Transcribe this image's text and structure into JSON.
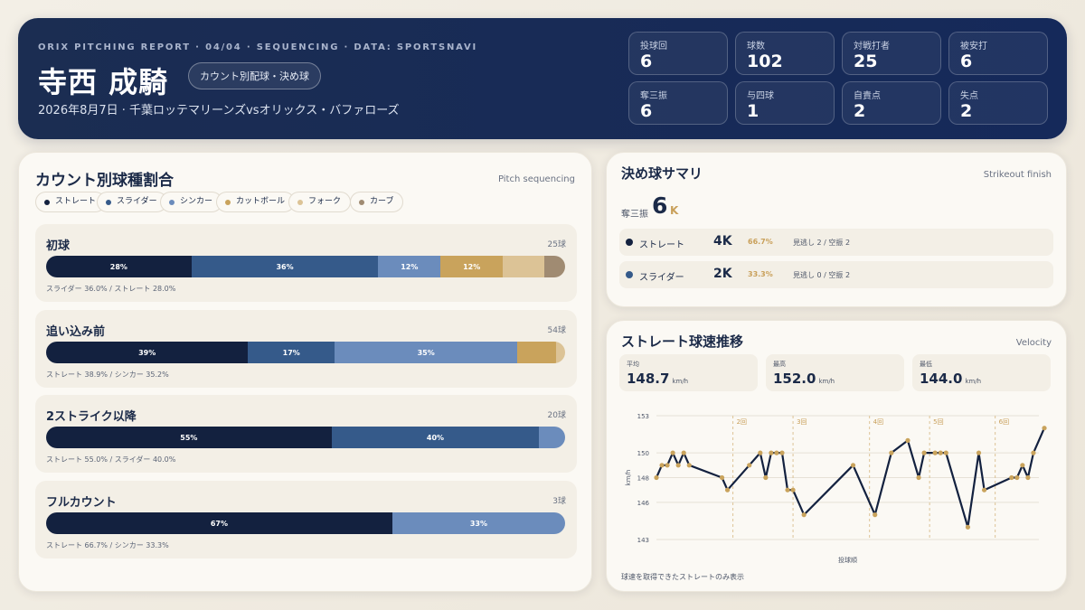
{
  "header": {
    "subtitle": "ORIX PITCHING REPORT · 04/04 · SEQUENCING · DATA: SPORTSNAVI",
    "pitcher_name": "寺西 成騎",
    "badge": "カウント別配球・決め球",
    "game": "2026年8月7日 · 千葉ロッテマリーンズvsオリックス・バファローズ",
    "stats": [
      {
        "label": "投球回",
        "value": "6"
      },
      {
        "label": "球数",
        "value": "102"
      },
      {
        "label": "対戦打者",
        "value": "25"
      },
      {
        "label": "被安打",
        "value": "6"
      },
      {
        "label": "奪三振",
        "value": "6"
      },
      {
        "label": "与四球",
        "value": "1"
      },
      {
        "label": "自責点",
        "value": "2"
      },
      {
        "label": "失点",
        "value": "2"
      }
    ]
  },
  "colors": {
    "straight": "#13213f",
    "slider": "#355a8a",
    "sinker": "#6b8cbc",
    "cutter": "#c9a35c",
    "fork": "#dcc396",
    "curve": "#a08b72"
  },
  "count_mix": {
    "title": "カウント別球種割合",
    "tag": "Pitch sequencing",
    "legend": [
      {
        "label": "ストレート",
        "color": "#13213f"
      },
      {
        "label": "スライダー",
        "color": "#355a8a"
      },
      {
        "label": "シンカー",
        "color": "#6b8cbc"
      },
      {
        "label": "カットボール",
        "color": "#c9a35c"
      },
      {
        "label": "フォーク",
        "color": "#dcc396"
      },
      {
        "label": "カーブ",
        "color": "#a08b72"
      }
    ],
    "sections": [
      {
        "name": "初球",
        "count": "25球",
        "segments": [
          {
            "pct": 28,
            "label": "28%",
            "color": "#13213f"
          },
          {
            "pct": 36,
            "label": "36%",
            "color": "#355a8a"
          },
          {
            "pct": 12,
            "label": "12%",
            "color": "#6b8cbc"
          },
          {
            "pct": 12,
            "label": "12%",
            "color": "#c9a35c"
          },
          {
            "pct": 8,
            "label": "",
            "color": "#dcc396"
          },
          {
            "pct": 4,
            "label": "",
            "color": "#a08b72"
          }
        ],
        "note": "スライダー 36.0% / ストレート 28.0%"
      },
      {
        "name": "追い込み前",
        "count": "54球",
        "segments": [
          {
            "pct": 38.9,
            "label": "39%",
            "color": "#13213f"
          },
          {
            "pct": 16.7,
            "label": "17%",
            "color": "#355a8a"
          },
          {
            "pct": 35.2,
            "label": "35%",
            "color": "#6b8cbc"
          },
          {
            "pct": 7.4,
            "label": "",
            "color": "#c9a35c"
          },
          {
            "pct": 1.8,
            "label": "",
            "color": "#dcc396"
          }
        ],
        "note": "ストレート 38.9% / シンカー 35.2%"
      },
      {
        "name": "2ストライク以降",
        "count": "20球",
        "segments": [
          {
            "pct": 55,
            "label": "55%",
            "color": "#13213f"
          },
          {
            "pct": 40,
            "label": "40%",
            "color": "#355a8a"
          },
          {
            "pct": 5,
            "label": "",
            "color": "#6b8cbc"
          }
        ],
        "note": "ストレート 55.0% / スライダー 40.0%"
      },
      {
        "name": "フルカウント",
        "count": "3球",
        "segments": [
          {
            "pct": 66.7,
            "label": "67%",
            "color": "#13213f"
          },
          {
            "pct": 33.3,
            "label": "33%",
            "color": "#6b8cbc"
          }
        ],
        "note": "ストレート 66.7% / シンカー 33.3%"
      }
    ]
  },
  "strikeout": {
    "title": "決め球サマリ",
    "tag": "Strikeout finish",
    "k_label": "奪三振",
    "k_value": "6",
    "k_unit": "K",
    "rows": [
      {
        "name": "ストレート",
        "value": "4K",
        "pct": "66.7%",
        "detail": "見逃し 2 / 空振 2",
        "color": "#13213f"
      },
      {
        "name": "スライダー",
        "value": "2K",
        "pct": "33.3%",
        "detail": "見逃し 0 / 空振 2",
        "color": "#355a8a"
      }
    ]
  },
  "velocity": {
    "title": "ストレート球速推移",
    "tag": "Velocity",
    "boxes": [
      {
        "label": "平均",
        "value": "148.7",
        "unit": "km/h"
      },
      {
        "label": "最高",
        "value": "152.0",
        "unit": "km/h"
      },
      {
        "label": "最低",
        "value": "144.0",
        "unit": "km/h"
      }
    ],
    "note": "球速を取得できたストレートのみ表示"
  },
  "chart_data": {
    "type": "line",
    "title": "",
    "xlabel": "投球順",
    "ylabel": "km/h",
    "ylim": [
      143,
      153
    ],
    "yticks": [
      143,
      146,
      148,
      150,
      153
    ],
    "grid": true,
    "line_color": "#13213f",
    "point_color": "#c9a35c",
    "inning_markers": [
      {
        "x": 14,
        "label": "2回"
      },
      {
        "x": 25,
        "label": "3回"
      },
      {
        "x": 39,
        "label": "4回"
      },
      {
        "x": 50,
        "label": "5回"
      },
      {
        "x": 62,
        "label": "6回"
      }
    ],
    "x_max": 70,
    "points": [
      {
        "x": 0,
        "y": 148
      },
      {
        "x": 1,
        "y": 149
      },
      {
        "x": 2,
        "y": 149
      },
      {
        "x": 3,
        "y": 150
      },
      {
        "x": 4,
        "y": 149
      },
      {
        "x": 5,
        "y": 150
      },
      {
        "x": 6,
        "y": 149
      },
      {
        "x": 12,
        "y": 148
      },
      {
        "x": 13,
        "y": 147
      },
      {
        "x": 17,
        "y": 149
      },
      {
        "x": 19,
        "y": 150
      },
      {
        "x": 20,
        "y": 148
      },
      {
        "x": 21,
        "y": 150
      },
      {
        "x": 22,
        "y": 150
      },
      {
        "x": 23,
        "y": 150
      },
      {
        "x": 24,
        "y": 147
      },
      {
        "x": 25,
        "y": 147
      },
      {
        "x": 27,
        "y": 145
      },
      {
        "x": 36,
        "y": 149
      },
      {
        "x": 40,
        "y": 145
      },
      {
        "x": 43,
        "y": 150
      },
      {
        "x": 46,
        "y": 151
      },
      {
        "x": 48,
        "y": 148
      },
      {
        "x": 49,
        "y": 150
      },
      {
        "x": 51,
        "y": 150
      },
      {
        "x": 52,
        "y": 150
      },
      {
        "x": 53,
        "y": 150
      },
      {
        "x": 57,
        "y": 144
      },
      {
        "x": 59,
        "y": 150
      },
      {
        "x": 60,
        "y": 147
      },
      {
        "x": 65,
        "y": 148
      },
      {
        "x": 66,
        "y": 148
      },
      {
        "x": 67,
        "y": 149
      },
      {
        "x": 68,
        "y": 148
      },
      {
        "x": 69,
        "y": 150
      },
      {
        "x": 71,
        "y": 152
      }
    ]
  }
}
